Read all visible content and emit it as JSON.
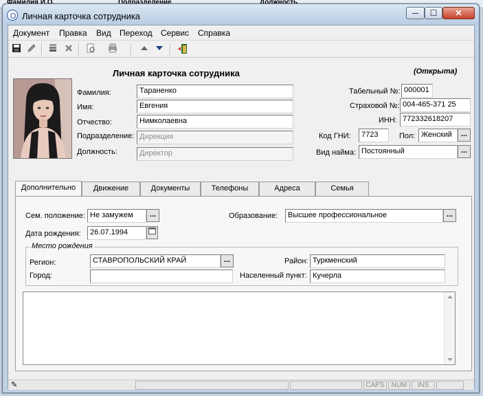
{
  "background_header": {
    "col1": "Фамилия И.О.",
    "col2": "Подразделение",
    "col3": "Должность"
  },
  "window": {
    "title": "Личная карточка сотрудника",
    "minimize": "─",
    "maximize": "☐",
    "close": "✕"
  },
  "menu": [
    "Документ",
    "Правка",
    "Вид",
    "Переход",
    "Сервис",
    "Справка"
  ],
  "toolbar_icons": [
    "save-icon",
    "edit-pencil-icon",
    "post-icon",
    "delete-icon",
    "preview-icon",
    "print-icon",
    "move-up-icon",
    "move-down-icon",
    "exit-door-icon"
  ],
  "card": {
    "title": "Личная карточка сотрудника",
    "status": "(Открыта)",
    "labels": {
      "last_name": "Фамилия:",
      "first_name": "Имя:",
      "patronymic": "Отчество:",
      "department": "Подразделение:",
      "position": "Должность:",
      "tab_number": "Табельный №:",
      "insurance": "Страховой №:",
      "inn": "ИНН:",
      "gni_code": "Код ГНИ:",
      "gender": "Пол:",
      "hire_type": "Вид найма:"
    },
    "values": {
      "last_name": "Тараненко",
      "first_name": "Евгения",
      "patronymic": "Нимколаевна",
      "department": "Дирекция",
      "position": "Директор",
      "tab_number": "000001",
      "insurance": "004-465-371 25",
      "inn": "772332618207",
      "gni_code": "7723",
      "gender": "Женский",
      "hire_type": "Постоянный"
    }
  },
  "tabs": [
    "Дополнительно",
    "Движение",
    "Документы",
    "Телефоны",
    "Адреса",
    "Семья"
  ],
  "extra": {
    "labels": {
      "marital": "Сем. положение:",
      "education": "Образование:",
      "birth_date": "Дата рождения:",
      "birth_place": "Место рождения",
      "region": "Регион:",
      "district": "Район:",
      "city": "Город:",
      "locality": "Населенный пункт:"
    },
    "values": {
      "marital": "Не замужем",
      "education": "Высшее профессиональное",
      "birth_date": "26.07.1994",
      "region": "СТАВРОПОЛЬСКИЙ КРАЙ",
      "district": "Туркменский",
      "city": "",
      "locality": "Кучерла"
    }
  },
  "status_bar": {
    "caps": "CAPS",
    "num": "NUM",
    "ins": "INS"
  },
  "colors": {
    "title_bar": "#c9d8ea",
    "close_button": "#c7412a",
    "window_border": "#5d7591"
  }
}
